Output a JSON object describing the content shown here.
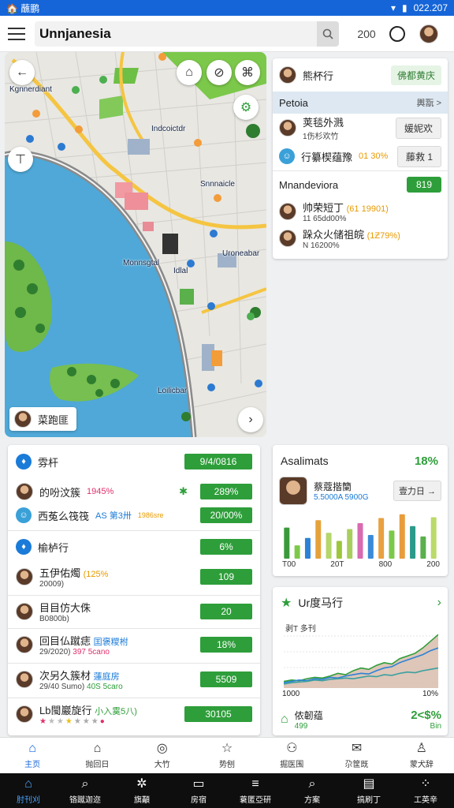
{
  "status": {
    "left": "🏠 蘸鹏",
    "time": "022.207"
  },
  "appbar": {
    "search_value": "Unnjanesia",
    "count": "200"
  },
  "map": {
    "labels": {
      "a": "Kgnnerdiant",
      "b": "Indcoictdr",
      "c": "Snnnaicle",
      "d": "Uroneabar",
      "e": "Idlal",
      "f": "Monnsgtal",
      "g": "Loilicbar"
    },
    "chip_label": "菜跑匪"
  },
  "right_panel": {
    "header": {
      "name": "熊杯行",
      "button": "佛都黄庆"
    },
    "section1": {
      "title": "Petoia",
      "link": "輿翫 >"
    },
    "row1": {
      "name": "荚毯外溅",
      "sub": "1伤杉欢竹",
      "button": "媛妮欢"
    },
    "row2": {
      "name": "行纂楔蕴豫",
      "pct": "01 30%",
      "button": "藤救 1"
    },
    "section2": {
      "title": "Mnandeviora",
      "badge": "819"
    },
    "row3": {
      "name": "帅荣短丁",
      "pct": "(61 19901)",
      "sub": "11 65dd00%"
    },
    "row4": {
      "name": "跺众火储祖皖",
      "pct": "(1Ƶ79%)",
      "sub": "N 16200%"
    }
  },
  "left_list": {
    "rows": [
      {
        "name": "雰杆",
        "value": "9/4/0816"
      },
      {
        "name": "的吩汶簇",
        "pct": "1945%",
        "value": "289%"
      },
      {
        "name": "西菟么筏筏",
        "pct": "AS 第3卅",
        "extra": "1986sre",
        "value": "20/00%"
      },
      {
        "name": "榆栌行",
        "value": "6%"
      },
      {
        "name": "五伊佑燭",
        "pct": "(125%",
        "sub": "20009)",
        "value": "109"
      },
      {
        "name": "目目仿大侏",
        "sub": "B0800b)",
        "value": "20"
      },
      {
        "name": "回目仏蹴痣",
        "pct": "囯褒糭柎",
        "sub": "29/2020)",
        "extra": "397 5cano",
        "value": "18%"
      },
      {
        "name": "次另久簇材",
        "pct": "蓮庭房",
        "sub": "29/40 Sumo)",
        "extra": "40S 5caro",
        "value": "5509"
      },
      {
        "name": "Lb閩巖旋行",
        "pct": "小入霙5八)",
        "value": "30105"
      }
    ]
  },
  "bar_card": {
    "title": "Asalimats",
    "percent": "18%",
    "person": {
      "name": "蔡蔻揩籣",
      "sub": "5.5000A 5900G",
      "button": "壹力日 →"
    },
    "ticks": [
      "T00",
      "20T",
      "800",
      "200"
    ]
  },
  "line_card": {
    "title": "Ur度马行",
    "legend": "剥T  多刊",
    "axis": [
      "1000",
      "10%"
    ],
    "footer": {
      "name": "侬韌蕴",
      "sub": "499",
      "value": "2<$%",
      "sub2": "Bin"
    }
  },
  "chart_data": [
    {
      "type": "bar",
      "title": "Asalimats",
      "categories": [
        "T00",
        "",
        "",
        "20T",
        "",
        "",
        "800",
        "",
        "",
        "200",
        "",
        "",
        "",
        "",
        ""
      ],
      "series": [
        {
          "values": [
            42,
            18,
            28,
            52,
            35,
            24,
            40,
            48,
            32,
            55,
            38,
            60,
            44,
            30,
            56
          ]
        }
      ],
      "colors": [
        "#3a9a3a",
        "#7cc94a",
        "#2c82d6",
        "#e6a23a",
        "#b4d66a",
        "#9dc63d",
        "#a8cf5d",
        "#d86bb0",
        "#3a8ad8",
        "#e8a040",
        "#7cc94a",
        "#e89c3a",
        "#2c9a8a",
        "#5ab04a",
        "#bada6a"
      ]
    },
    {
      "type": "area",
      "title": "Ur度马行",
      "x": [
        0,
        1,
        2,
        3,
        4,
        5,
        6,
        7,
        8,
        9,
        10,
        11,
        12,
        13,
        14,
        15,
        16,
        17,
        18,
        19,
        20
      ],
      "series": [
        {
          "values": [
            10,
            12,
            11,
            14,
            16,
            15,
            18,
            22,
            20,
            26,
            30,
            28,
            34,
            38,
            36,
            44,
            48,
            52,
            60,
            70,
            80
          ]
        },
        {
          "values": [
            8,
            10,
            12,
            11,
            14,
            13,
            16,
            15,
            18,
            20,
            22,
            21,
            26,
            30,
            32,
            38,
            42,
            46,
            50,
            56,
            60
          ]
        },
        {
          "values": [
            6,
            8,
            9,
            10,
            12,
            11,
            13,
            14,
            15,
            14,
            16,
            18,
            17,
            20,
            19,
            22,
            24,
            23,
            26,
            28,
            30
          ]
        }
      ]
    }
  ],
  "bottom_nav": [
    "主页",
    "抛回日",
    "大竹",
    "势刨",
    "掘医围",
    "尕筐既",
    "蒙犬辞"
  ],
  "system_nav": [
    "肘刊刈",
    "铬蹴迦迩",
    "旗顢",
    "房宿",
    "蓑匿亞研",
    "方案",
    "搞刷丁",
    "工英辛"
  ]
}
